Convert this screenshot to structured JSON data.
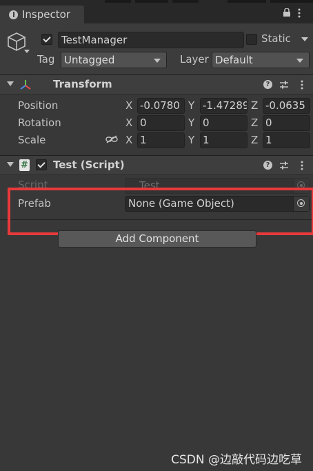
{
  "window": {
    "tab_label": "Inspector"
  },
  "header": {
    "object_name": "TestManager",
    "active_checked": true,
    "static_label": "Static",
    "tag_label": "Tag",
    "tag_value": "Untagged",
    "layer_label": "Layer",
    "layer_value": "Default"
  },
  "transform": {
    "title": "Transform",
    "rows": [
      {
        "label": "Position",
        "x": "-0.0780",
        "y": "-1.47289",
        "z": "-0.0635"
      },
      {
        "label": "Rotation",
        "x": "0",
        "y": "0",
        "z": "0"
      },
      {
        "label": "Scale",
        "x": "1",
        "y": "1",
        "z": "1"
      }
    ],
    "axis_labels": [
      "X",
      "Y",
      "Z"
    ]
  },
  "script_component": {
    "title": "Test (Script)",
    "enabled": true,
    "script_label": "Script",
    "script_value": "Test",
    "prefab_label": "Prefab",
    "prefab_value": "None (Game Object)"
  },
  "add_component_label": "Add Component",
  "watermark": "CSDN @边敲代码边吃草",
  "colors": {
    "highlight": "#e8393b",
    "background": "#383838"
  }
}
